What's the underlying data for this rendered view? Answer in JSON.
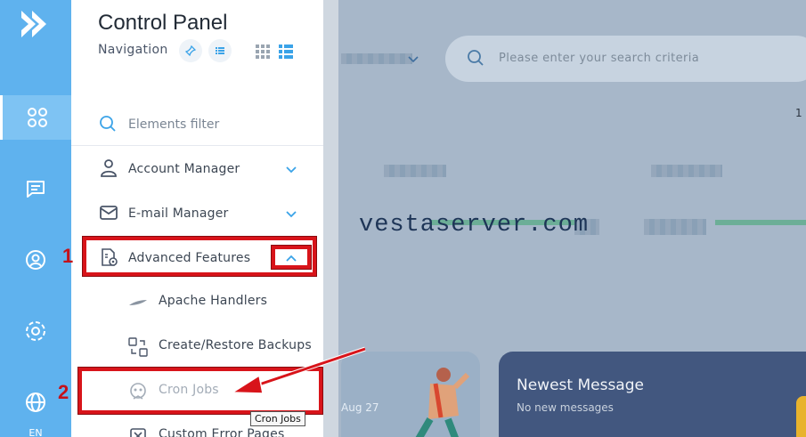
{
  "rail": {
    "language": "EN",
    "items": [
      {
        "icon": "dashboard-icon",
        "active": true
      },
      {
        "icon": "chat-icon",
        "active": false
      },
      {
        "icon": "user-circle-icon",
        "active": false
      },
      {
        "icon": "settings-icon",
        "active": false
      },
      {
        "icon": "globe-icon",
        "active": false
      }
    ]
  },
  "panel": {
    "title": "Control Panel",
    "nav_label": "Navigation",
    "filter_placeholder": "Elements filter",
    "menu": [
      {
        "label": "Account Manager",
        "icon": "user-icon",
        "expanded": false
      },
      {
        "label": "E-mail Manager",
        "icon": "mail-icon",
        "expanded": false
      },
      {
        "label": "Advanced Features",
        "icon": "advanced-features-icon",
        "expanded": true
      }
    ],
    "submenu": [
      {
        "label": "Apache Handlers",
        "icon": "feather-icon"
      },
      {
        "label": "Create/Restore Backups",
        "icon": "backup-icon"
      },
      {
        "label": "Cron Jobs",
        "icon": "cron-icon"
      },
      {
        "label": "Custom Error Pages",
        "icon": "error-page-icon"
      }
    ]
  },
  "main": {
    "search_placeholder": "Please enter your search criteria",
    "page_number": "1",
    "watermark": "vestaserver.com",
    "card_date": "Aug 27",
    "newest_message_title": "Newest Message",
    "newest_message_sub": "No new messages"
  },
  "annotations": {
    "step1": "1",
    "step2": "2",
    "tooltip": "Cron Jobs"
  },
  "colors": {
    "rail": "#5fb2ee",
    "accent": "#3aa3e8",
    "annotation_red": "#d8141a"
  }
}
